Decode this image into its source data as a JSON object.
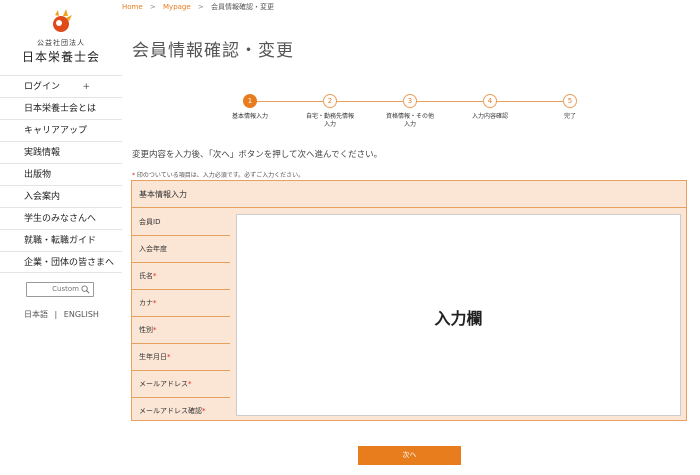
{
  "colors": {
    "accent": "#e87d1e",
    "form_bg": "#fbe5d4",
    "required": "#dd2222"
  },
  "logo": {
    "org_small": "公益社団法人",
    "org_big": "日本栄養士会"
  },
  "sidebar": {
    "items": [
      {
        "label": "ログイン",
        "suffix": "+"
      },
      {
        "label": "日本栄養士会とは"
      },
      {
        "label": "キャリアアップ"
      },
      {
        "label": "実践情報"
      },
      {
        "label": "出版物"
      },
      {
        "label": "入会案内"
      },
      {
        "label": "学生のみなさんへ"
      },
      {
        "label": "就職・転職ガイド"
      },
      {
        "label": "企業・団体の皆さまへ"
      }
    ],
    "search": {
      "placeholder": "Custom",
      "icon": "search-icon"
    },
    "lang": {
      "ja": "日本語",
      "sep": "|",
      "en": "ENGLISH"
    }
  },
  "breadcrumb": {
    "home": "Home",
    "sep": ">",
    "mypage": "Mypage",
    "current": "会員情報確認・変更"
  },
  "page_title": "会員情報確認・変更",
  "steps": [
    {
      "num": "1",
      "label": "基本情報入力",
      "active": true
    },
    {
      "num": "2",
      "label": "自宅・勤務先情報入力",
      "active": false
    },
    {
      "num": "3",
      "label": "資格情報・その他入力",
      "active": false
    },
    {
      "num": "4",
      "label": "入力内容確認",
      "active": false
    },
    {
      "num": "5",
      "label": "完了",
      "active": false
    }
  ],
  "instruction": "変更内容を入力後、「次へ」ボタンを押して次へ進んでください。",
  "note": {
    "mark": "*",
    "text": "印のついている項目は、入力必須です。必ずご入力ください。"
  },
  "form": {
    "header": "基本情報入力",
    "rows": [
      {
        "label": "会員ID",
        "required": false
      },
      {
        "label": "入会年度",
        "required": false
      },
      {
        "label": "氏名",
        "required": true
      },
      {
        "label": "カナ",
        "required": true
      },
      {
        "label": "性別",
        "required": true
      },
      {
        "label": "生年月日",
        "required": true
      },
      {
        "label": "メールアドレス",
        "required": true
      },
      {
        "label": "メールアドレス確認",
        "required": true
      }
    ],
    "input_area_label": "入力欄"
  },
  "next_button": "次へ"
}
